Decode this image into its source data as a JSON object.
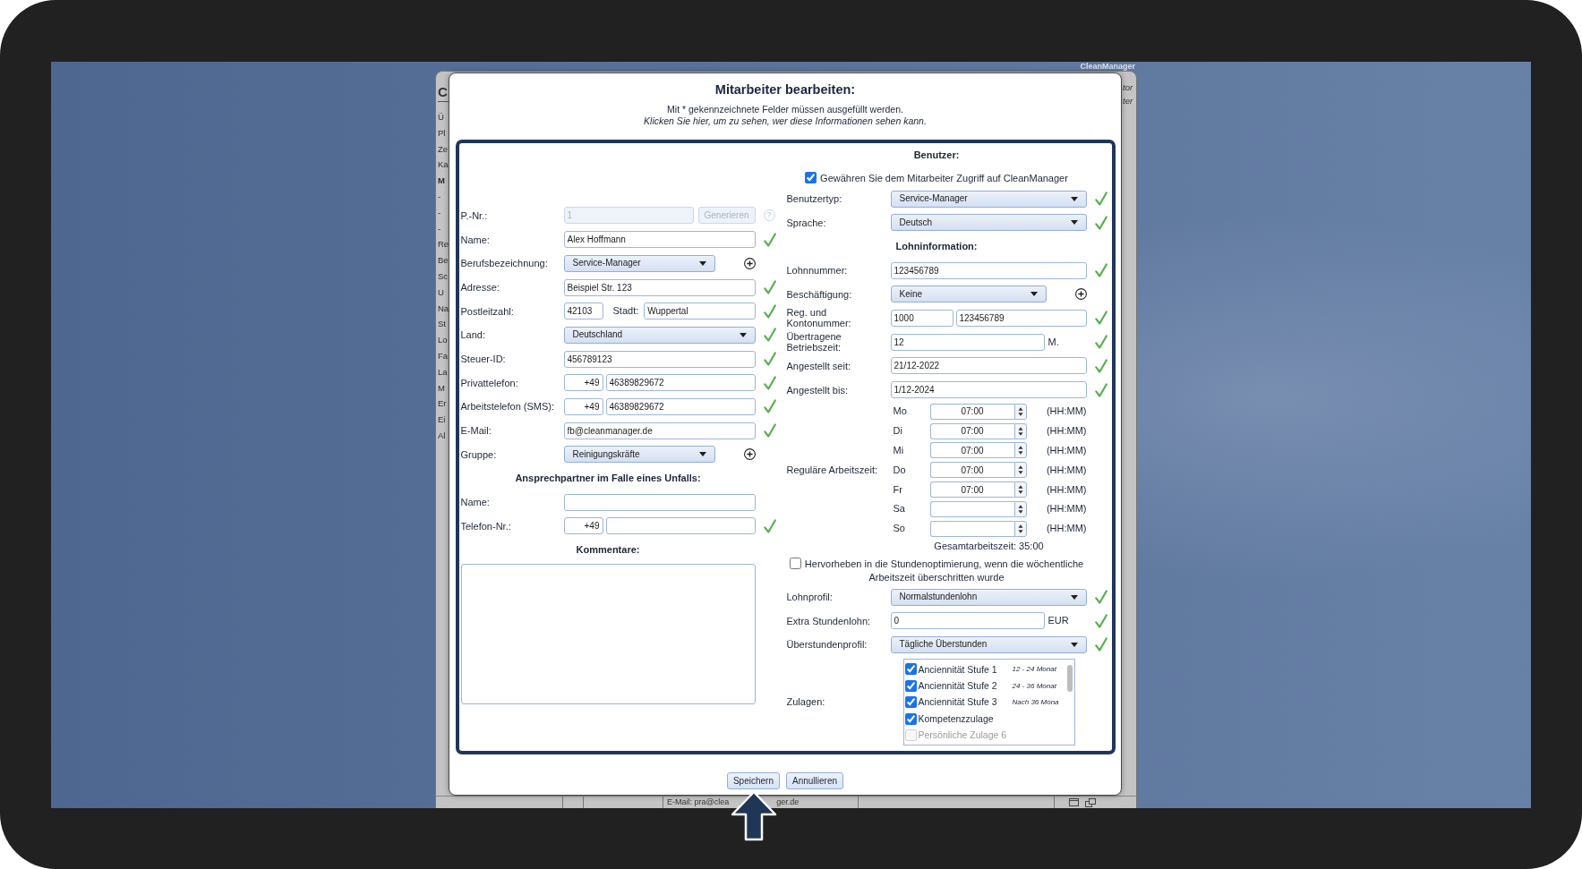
{
  "background_window": {
    "app_name": "CleanManager",
    "title": "C",
    "sidebar_items": [
      {
        "label": "Ü",
        "selected": false
      },
      {
        "label": "Pl",
        "selected": false
      },
      {
        "label": "Ze",
        "selected": false
      },
      {
        "label": "Ka",
        "selected": false
      },
      {
        "label": "M",
        "selected": true
      },
      {
        "label": "-",
        "selected": false
      },
      {
        "label": "-",
        "selected": false
      },
      {
        "label": "-",
        "selected": false
      },
      {
        "label": "Re",
        "selected": false
      },
      {
        "label": "Be",
        "selected": false
      },
      {
        "label": "Sc",
        "selected": false
      },
      {
        "label": "U",
        "selected": false
      },
      {
        "label": "Na",
        "selected": false
      },
      {
        "label": "St",
        "selected": false
      },
      {
        "label": "Lo",
        "selected": false
      },
      {
        "label": "Fa",
        "selected": false
      },
      {
        "label": "La",
        "selected": false
      },
      {
        "label": "M",
        "selected": false
      },
      {
        "label": "Er",
        "selected": false
      },
      {
        "label": "Ei",
        "selected": false
      },
      {
        "label": "Al",
        "selected": false
      }
    ],
    "header_links": [
      "tor",
      "ter"
    ],
    "footer_texts": [
      "E-Mail: pra@clea",
      "ger.de"
    ]
  },
  "dialog": {
    "title": "Mitarbeiter bearbeiten:",
    "note": "Mit * gekennzeichnete Felder müssen ausgefüllt werden.",
    "info_link": "Klicken Sie hier, um zu sehen, wer diese Informationen sehen kann.",
    "left_sections": [
      {
        "fields": [
          {
            "kind": "generated",
            "label": "P.-Nr.:",
            "value": "1",
            "button": "Generieren",
            "help": "?",
            "disabled": true,
            "valid": false,
            "can_add": false
          },
          {
            "kind": "text",
            "label": "Name:",
            "value": "Alex Hoffmann",
            "disabled": false,
            "valid": true,
            "can_add": false
          },
          {
            "kind": "select",
            "label": "Berufsbezeichnung:",
            "value": "Service-Manager",
            "disabled": false,
            "valid": false,
            "can_add": true
          },
          {
            "kind": "text",
            "label": "Adresse:",
            "value": "Beispiel Str. 123",
            "disabled": false,
            "valid": true,
            "can_add": false
          },
          {
            "kind": "zip_city",
            "label": "Postleitzahl:",
            "value": "42103",
            "middle_label": "Stadt:",
            "value_2": "Wuppertal",
            "disabled": false,
            "valid": true,
            "can_add": false
          },
          {
            "kind": "select",
            "label": "Land:",
            "value": "Deutschland",
            "disabled": false,
            "valid": true,
            "can_add": false
          },
          {
            "kind": "text",
            "label": "Steuer-ID:",
            "value": "456789123",
            "disabled": false,
            "valid": true,
            "can_add": false
          },
          {
            "kind": "phone",
            "label": "Privattelefon:",
            "value": "+49",
            "value_2": "46389829672",
            "disabled": false,
            "valid": true,
            "can_add": false
          },
          {
            "kind": "phone",
            "label": "Arbeitstelefon (SMS):",
            "value": "+49",
            "value_2": "46389829672",
            "disabled": false,
            "valid": true,
            "can_add": false
          },
          {
            "kind": "text",
            "label": "E-Mail:",
            "value": "fb@cleanmanager.de",
            "disabled": false,
            "valid": true,
            "can_add": false
          },
          {
            "kind": "select",
            "label": "Gruppe:",
            "value": "Reinigungskräfte",
            "disabled": false,
            "valid": false,
            "can_add": true
          }
        ]
      },
      {
        "heading": "Ansprechpartner im Falle eines Unfalls:",
        "fields": [
          {
            "kind": "text",
            "label": "Name:",
            "disabled": false,
            "valid": false,
            "can_add": false
          },
          {
            "kind": "phone",
            "label": "Telefon-Nr.:",
            "value": "+49",
            "disabled": false,
            "valid": true,
            "can_add": false
          }
        ]
      },
      {
        "heading": "Kommentare:",
        "fields": [
          {
            "kind": "textarea",
            "disabled": false,
            "valid": false,
            "can_add": false
          }
        ]
      }
    ],
    "right_sections": [
      {
        "heading": "Benutzer:",
        "fields": [
          {
            "kind": "checkbox",
            "label": "Gewähren Sie dem Mitarbeiter Zugriff auf CleanManager",
            "checked": true,
            "disabled": false,
            "valid": false,
            "can_add": false
          },
          {
            "kind": "select",
            "label": "Benutzertyp:",
            "value": "Service-Manager",
            "disabled": false,
            "valid": true,
            "can_add": false
          },
          {
            "kind": "select",
            "label": "Sprache:",
            "value": "Deutsch",
            "disabled": false,
            "valid": true,
            "can_add": false
          }
        ]
      },
      {
        "heading": "Lohninformation:",
        "fields": [
          {
            "kind": "text",
            "label": "Lohnnummer:",
            "value": "123456789",
            "disabled": false,
            "valid": true,
            "can_add": false
          },
          {
            "kind": "select",
            "label": "Beschäftigung:",
            "value": "Keine",
            "disabled": false,
            "valid": false,
            "can_add": true
          },
          {
            "kind": "pair",
            "label": "Reg. und Kontonummer:",
            "value": "1000",
            "value_2": "123456789",
            "disabled": false,
            "valid": true,
            "can_add": false
          },
          {
            "kind": "text",
            "label": "Übertragene Betriebszeit:",
            "value": "12",
            "unit": "M.",
            "disabled": false,
            "valid": true,
            "can_add": false
          },
          {
            "kind": "text",
            "label": "Angestellt seit:",
            "value": "21/12-2022",
            "disabled": false,
            "valid": true,
            "can_add": false
          },
          {
            "kind": "text",
            "label": "Angestellt bis:",
            "value": "1/12-2024",
            "disabled": false,
            "valid": true,
            "can_add": false
          },
          {
            "kind": "schedule",
            "label": "Reguläre Arbeitszeit:",
            "days": [
              {
                "day": "Mo",
                "value": "07:00",
                "format": "(HH:MM)"
              },
              {
                "day": "Di",
                "value": "07:00",
                "format": "(HH:MM)"
              },
              {
                "day": "Mi",
                "value": "07:00",
                "format": "(HH:MM)"
              },
              {
                "day": "Do",
                "value": "07:00",
                "format": "(HH:MM)"
              },
              {
                "day": "Fr",
                "value": "07:00",
                "format": "(HH:MM)"
              },
              {
                "day": "Sa",
                "format": "(HH:MM)"
              },
              {
                "day": "So",
                "format": "(HH:MM)"
              }
            ],
            "total": "Gesamtarbeitszeit: 35:00",
            "disabled": false,
            "valid": false,
            "can_add": false
          },
          {
            "kind": "checkbox",
            "label": "Hervorheben in die Stundenoptimierung, wenn die wöchentliche Arbeitszeit überschritten wurde",
            "checked": false,
            "disabled": false,
            "valid": false,
            "can_add": false
          },
          {
            "kind": "select",
            "label": "Lohnprofil:",
            "value": "Normalstundenlohn",
            "disabled": false,
            "valid": true,
            "can_add": false
          },
          {
            "kind": "text",
            "label": "Extra Stundenlohn:",
            "value": "0",
            "unit": "EUR",
            "disabled": false,
            "valid": true,
            "can_add": false
          },
          {
            "kind": "select",
            "label": "Überstundenprofil:",
            "value": "Tägliche Überstunden",
            "disabled": false,
            "valid": true,
            "can_add": false
          },
          {
            "kind": "checklist",
            "label": "Zulagen:",
            "items": [
              {
                "label": "Anciennität Stufe 1",
                "note": "12 - 24 Monat",
                "checked": true,
                "disabled": false
              },
              {
                "label": "Anciennität Stufe 2",
                "note": "24 - 36 Monat",
                "checked": true,
                "disabled": false
              },
              {
                "label": "Anciennität Stufe 3",
                "note": "Nach 36 Mona",
                "checked": true,
                "disabled": false
              },
              {
                "label": "Kompetenzzulage",
                "checked": true,
                "disabled": false
              },
              {
                "label": "Persönliche Zulage 6",
                "checked": false,
                "disabled": true
              }
            ],
            "disabled": false,
            "valid": false,
            "can_add": false
          }
        ]
      }
    ],
    "buttons": [
      {
        "label": "Speichern"
      },
      {
        "label": "Annullieren"
      }
    ]
  }
}
